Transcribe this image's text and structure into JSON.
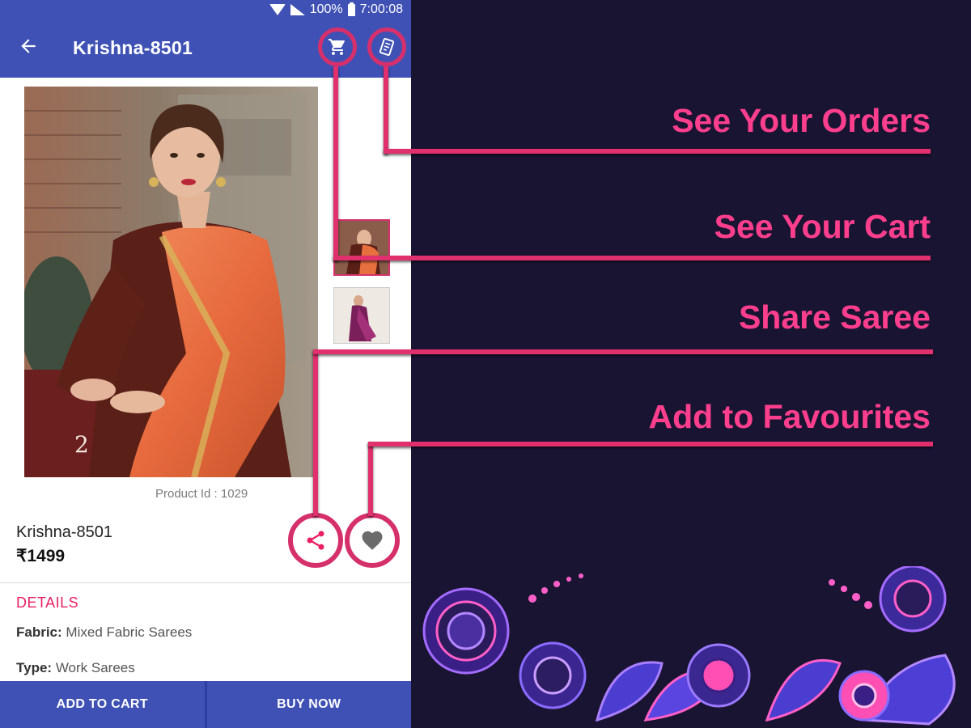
{
  "status_bar": {
    "battery": "100%",
    "time": "7:00:08"
  },
  "app_bar": {
    "title": "Krishna-8501",
    "back_icon": "arrow-back-icon",
    "cart_icon": "cart-icon",
    "orders_icon": "orders-receipt-icon"
  },
  "product": {
    "product_id": "Product Id : 1029",
    "name": "Krishna-8501",
    "price": "₹1499",
    "details_heading": "DETAILS",
    "specs": [
      {
        "label": "Fabric:",
        "value": "Mixed Fabric Sarees"
      },
      {
        "label": "Type:",
        "value": "Work Sarees"
      }
    ],
    "board_number": "2"
  },
  "actions": {
    "add_to_cart": "ADD TO CART",
    "buy_now": "BUY NOW"
  },
  "callouts": {
    "orders": "See Your Orders",
    "cart": "See Your Cart",
    "share": "Share Saree",
    "favourites": "Add to Favourites"
  },
  "colors": {
    "primary": "#3f51b5",
    "accent": "#e91e63",
    "callout": "#ff3f8e",
    "line": "#e0306d",
    "background": "#1a1433"
  }
}
